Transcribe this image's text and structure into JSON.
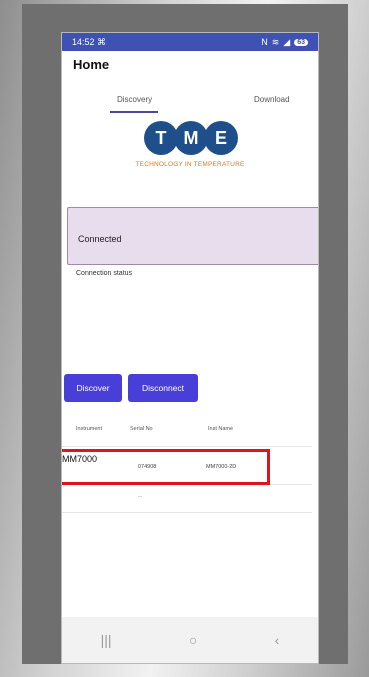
{
  "statusbar": {
    "time": "14:52",
    "left_icon": "screenshot-icon",
    "right_icons": [
      "nfc-icon",
      "wifi-icon",
      "signal-icon"
    ],
    "battery": "63"
  },
  "header": {
    "title": "Home"
  },
  "tabs": [
    {
      "label": "Discovery",
      "active": true
    },
    {
      "label": "Download",
      "active": false
    }
  ],
  "logo": {
    "letters": [
      "T",
      "M",
      "E"
    ],
    "tagline": "TECHNOLOGY IN TEMPERATURE",
    "brand_color": "#1e4f8a",
    "tagline_color": "#e07a1f"
  },
  "connection": {
    "status": "Connected",
    "label": "Connection status"
  },
  "buttons": {
    "discover": "Discover",
    "disconnect": "Disconnect",
    "color": "#4a3ed9"
  },
  "table": {
    "headers": [
      "Instrument",
      "Serial No",
      "Inst Name"
    ],
    "rows": [
      {
        "instrument": "MM7000",
        "serial": "074908",
        "name": "MM7000-2D"
      },
      {
        "instrument": "",
        "serial": "--",
        "name": ""
      }
    ]
  },
  "highlight_color": "#e0141e",
  "navbar": [
    "recent-apps-icon",
    "home-icon",
    "back-icon"
  ]
}
